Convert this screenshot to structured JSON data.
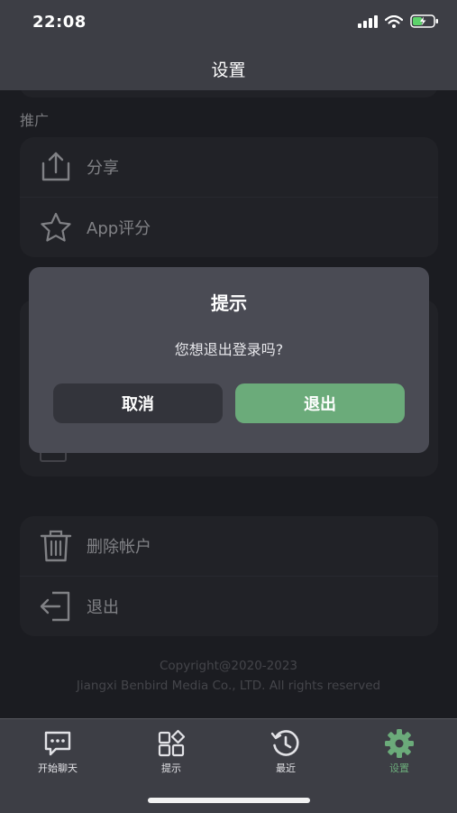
{
  "status_bar": {
    "time": "22:08"
  },
  "nav": {
    "title": "设置"
  },
  "sections": {
    "promote_label": "推广",
    "promote_items": [
      {
        "icon": "share-icon",
        "label": "分享"
      },
      {
        "icon": "star-icon",
        "label": "App评分"
      }
    ],
    "account_items": [
      {
        "icon": "trash-icon",
        "label": "删除帐户"
      },
      {
        "icon": "logout-icon",
        "label": "退出"
      }
    ]
  },
  "copyright": {
    "line1": "Copyright@2020-2023",
    "line2": "Jiangxi Benbird Media Co., LTD. All rights reserved"
  },
  "dialog": {
    "title": "提示",
    "message": "您想退出登录吗?",
    "cancel_label": "取消",
    "confirm_label": "退出"
  },
  "tabbar": {
    "tabs": [
      {
        "icon": "chat-icon",
        "label": "开始聊天",
        "active": false
      },
      {
        "icon": "tips-grid-icon",
        "label": "提示",
        "active": false
      },
      {
        "icon": "history-icon",
        "label": "最近",
        "active": false
      },
      {
        "icon": "settings-gear-icon",
        "label": "设置",
        "active": true
      }
    ]
  },
  "colors": {
    "accent": "#6bab7a",
    "background": "#222428",
    "card": "#2d2e34",
    "bar": "#3d3e45",
    "dialog": "#4a4b54"
  }
}
